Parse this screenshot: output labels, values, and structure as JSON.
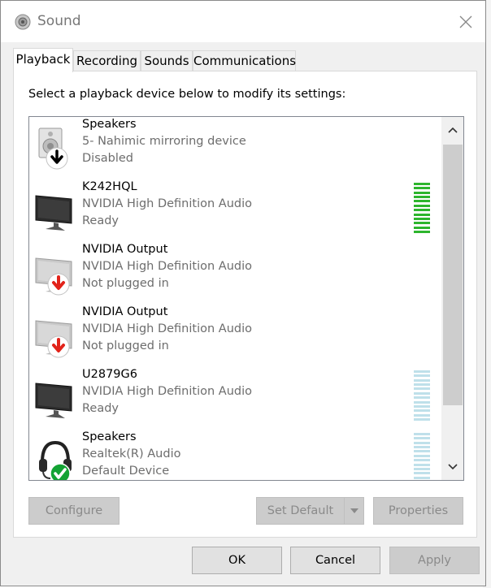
{
  "window": {
    "title": "Sound",
    "close_glyph": "✕"
  },
  "tabs": [
    {
      "label": "Playback",
      "active": true
    },
    {
      "label": "Recording",
      "active": false
    },
    {
      "label": "Sounds",
      "active": false
    },
    {
      "label": "Communications",
      "active": false
    }
  ],
  "instruction": "Select a playback device below to modify its settings:",
  "devices": [
    {
      "name": "Speakers",
      "description": "5- Nahimic mirroring device",
      "status": "Disabled",
      "icon": "speaker-disabled-icon",
      "meter": "none"
    },
    {
      "name": "K242HQL",
      "description": "NVIDIA High Definition Audio",
      "status": "Ready",
      "icon": "monitor-icon",
      "meter": "active"
    },
    {
      "name": "NVIDIA Output",
      "description": "NVIDIA High Definition Audio",
      "status": "Not plugged in",
      "icon": "monitor-unplugged-icon",
      "meter": "none"
    },
    {
      "name": "NVIDIA Output",
      "description": "NVIDIA High Definition Audio",
      "status": "Not plugged in",
      "icon": "monitor-unplugged-icon",
      "meter": "none"
    },
    {
      "name": "U2879G6",
      "description": "NVIDIA High Definition Audio",
      "status": "Ready",
      "icon": "monitor-icon",
      "meter": "idle"
    },
    {
      "name": "Speakers",
      "description": "Realtek(R) Audio",
      "status": "Default Device",
      "icon": "headset-default-icon",
      "meter": "idle"
    }
  ],
  "buttons": {
    "configure": "Configure",
    "set_default": "Set Default",
    "properties": "Properties",
    "ok": "OK",
    "cancel": "Cancel",
    "apply": "Apply"
  },
  "colors": {
    "meter_active": "#2db52d",
    "meter_idle": "#bfe0ea",
    "default_check": "#13a334",
    "unplugged_arrow": "#e2231a"
  }
}
